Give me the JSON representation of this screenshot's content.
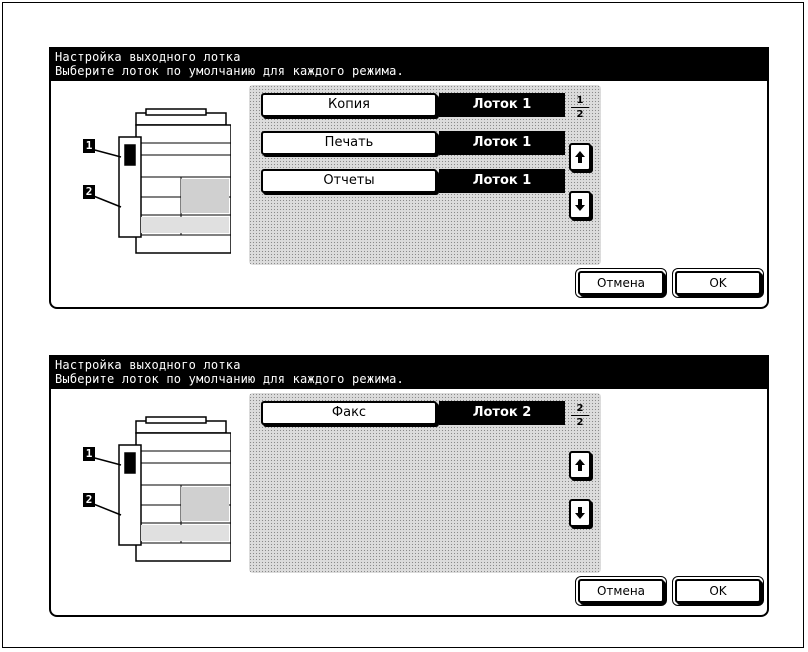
{
  "screens": [
    {
      "header_line1": "Настройка выходного лотка",
      "header_line2": "Выберите лоток по умолчанию для каждого режима.",
      "rows": [
        {
          "mode": "Копия",
          "tray": "Лоток 1"
        },
        {
          "mode": "Печать",
          "tray": "Лоток 1"
        },
        {
          "mode": "Отчеты",
          "tray": "Лоток 1"
        }
      ],
      "page_current": "1",
      "page_total": "2",
      "tray_label_1": "1",
      "tray_label_2": "2",
      "cancel_label": "Отмена",
      "ok_label": "OK"
    },
    {
      "header_line1": "Настройка выходного лотка",
      "header_line2": "Выберите лоток по умолчанию для каждого режима.",
      "rows": [
        {
          "mode": "Факс",
          "tray": "Лоток 2"
        }
      ],
      "page_current": "2",
      "page_total": "2",
      "tray_label_1": "1",
      "tray_label_2": "2",
      "cancel_label": "Отмена",
      "ok_label": "OK"
    }
  ],
  "icons": {
    "up": "arrow-up-icon",
    "down": "arrow-down-icon",
    "machine": "printer-illustration"
  }
}
